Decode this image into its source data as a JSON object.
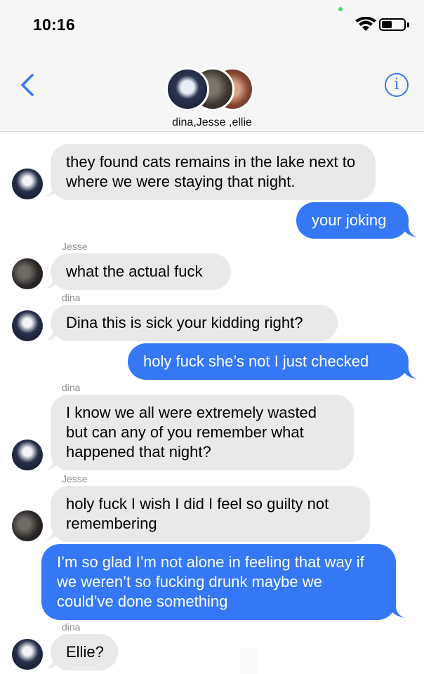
{
  "status_bar": {
    "time": "10:16"
  },
  "header": {
    "group_name": "dina,Jesse ,ellie",
    "back_icon": "chevron-left-icon",
    "info_icon": "info-icon",
    "info_label": "i"
  },
  "messages": [
    {
      "direction": "in",
      "sender": "",
      "text": "they found cats remains in the lake next to where we were staying that night."
    },
    {
      "direction": "out",
      "text": "your joking"
    },
    {
      "direction": "in",
      "sender": "Jesse",
      "text": "what the actual fuck"
    },
    {
      "direction": "in",
      "sender": "dina",
      "text": "Dina this is sick your kidding right?"
    },
    {
      "direction": "out",
      "text": "holy fuck she’s not I just checked"
    },
    {
      "direction": "in",
      "sender": "dina",
      "text": "I know we all were extremely wasted but can any of you remember what happened that night?"
    },
    {
      "direction": "in",
      "sender": "Jesse",
      "text": "holy fuck I wish I did I feel so guilty not remembering"
    },
    {
      "direction": "out",
      "text": "I’m so glad I’m not alone in feeling that way if we weren’t so fucking drunk maybe we could’ve done something"
    },
    {
      "direction": "in",
      "sender": "dina",
      "text": "Ellie?"
    }
  ],
  "colors": {
    "outgoing": "#3478f6",
    "incoming": "#e9e9eb",
    "accent": "#3478f6"
  }
}
